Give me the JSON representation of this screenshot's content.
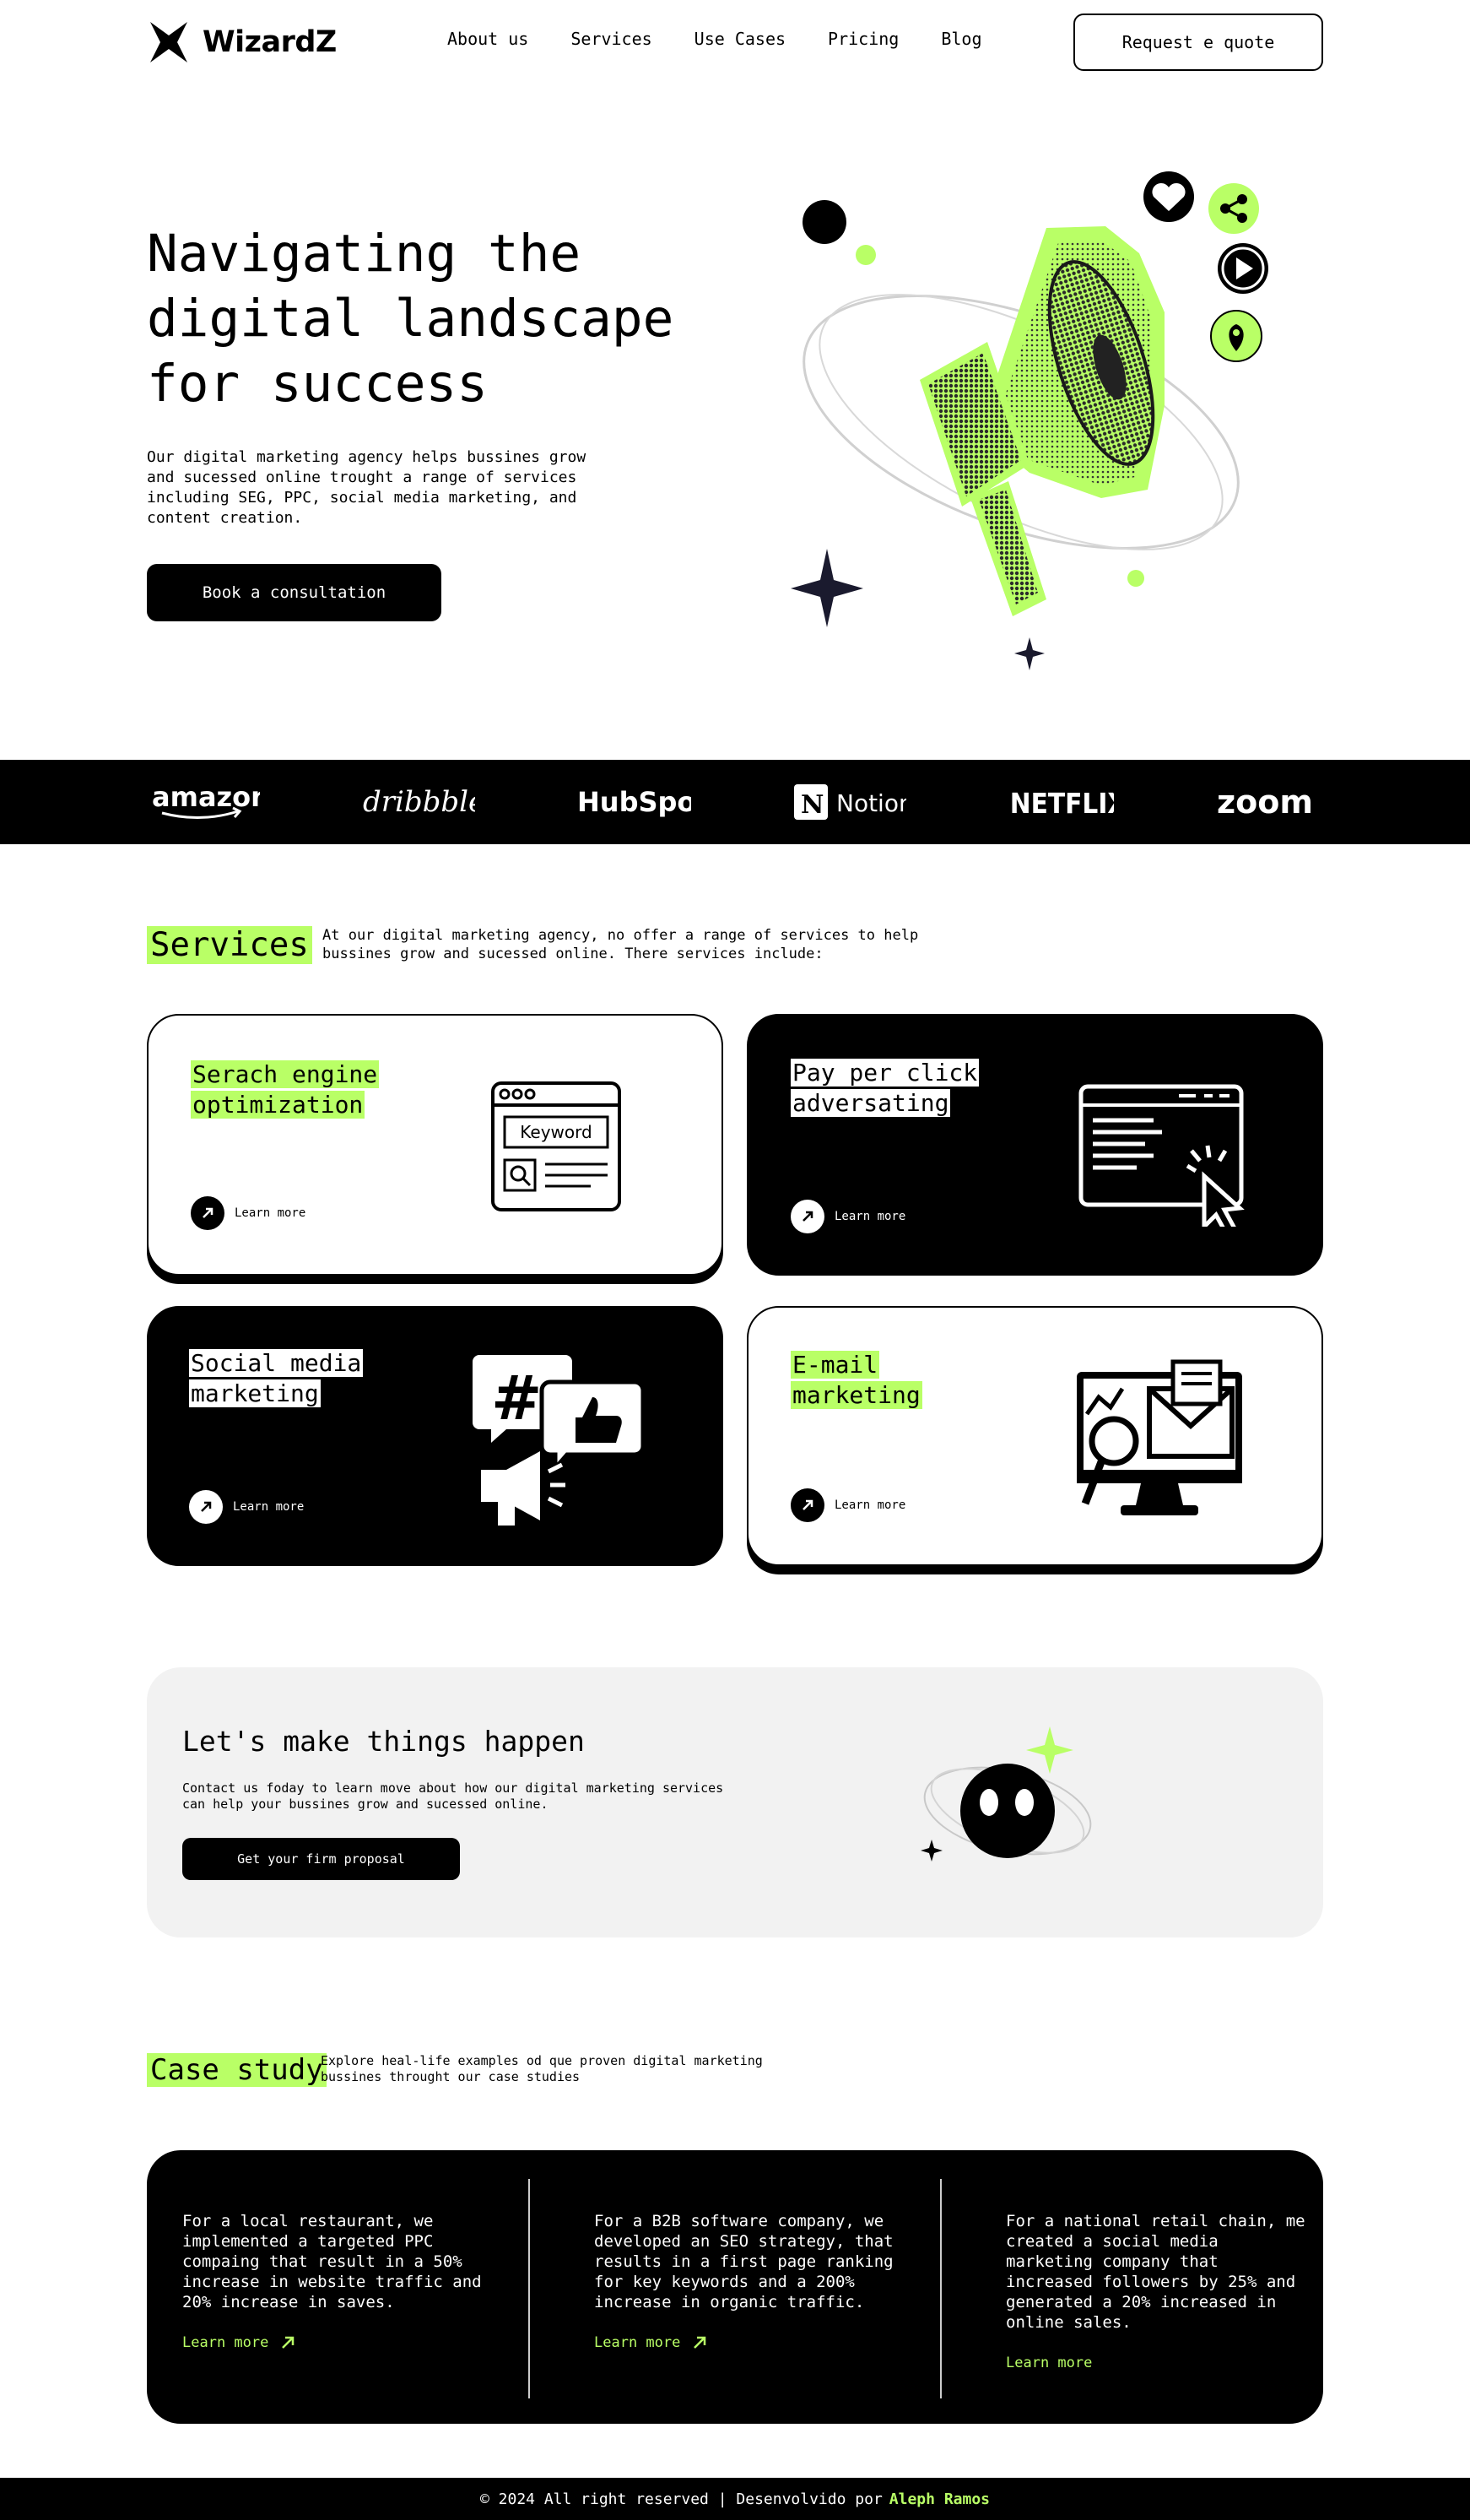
{
  "brand": {
    "name": "WizardZ"
  },
  "nav": {
    "items": [
      "About us",
      "Services",
      "Use Cases",
      "Pricing",
      "Blog"
    ]
  },
  "header": {
    "quote_button": "Request e quote"
  },
  "hero": {
    "title": "Navigating the digital landscape for success",
    "description": "Our digital marketing agency helps bussines grow and sucessed online trought a range of services including SEG, PPC, social media marketing, and content creation.",
    "cta": "Book a consultation"
  },
  "partners": [
    "amazon",
    "dribbble",
    "HubSpot",
    "Notion",
    "NETFLIX",
    "zoom"
  ],
  "services": {
    "heading": "Services",
    "intro": "At our digital marketing agency, no offer a range of services to help bussines grow and sucessed online. There services include:",
    "cards": [
      {
        "title_line1": "Serach engine",
        "title_line2": "optimization",
        "learn_more": "Learn more",
        "icon_keyword": "Keyword"
      },
      {
        "title_line1": "Pay per click",
        "title_line2": "adversating",
        "learn_more": "Learn more"
      },
      {
        "title_line1": "Social media",
        "title_line2": "marketing",
        "learn_more": "Learn more"
      },
      {
        "title_line1": "E-mail",
        "title_line2": "marketing",
        "learn_more": "Learn more"
      }
    ]
  },
  "cta": {
    "title": "Let's make things happen",
    "text": "Contact us foday to learn move about how our digital marketing services can help your bussines grow and sucessed online.",
    "button": "Get your firm proposal"
  },
  "case_study": {
    "heading": "Case study",
    "intro": "Explore heal-life examples od que proven digital marketing bussines throught our case studies",
    "items": [
      {
        "text": "For a local restaurant, we implemented a targeted PPC compaing that result in a 50% increase in website traffic and 20% increase in saves.",
        "link": "Learn more"
      },
      {
        "text": "For a B2B software company, we developed an SEO strategy, that results in a first page ranking for key keywords and a 200% increase in organic traffic.",
        "link": "Learn more"
      },
      {
        "text": "For a national retail chain, me created a social media marketing company that increased followers by 25% and generated a 20% increased in online sales.",
        "link": "Learn more"
      }
    ]
  },
  "footer": {
    "text": "© 2024 All right reserved | Desenvolvido por",
    "author": "Aleph Ramos"
  },
  "colors": {
    "accent": "#b9ff66",
    "dark": "#000000",
    "light_gray": "#f2f2f2"
  }
}
